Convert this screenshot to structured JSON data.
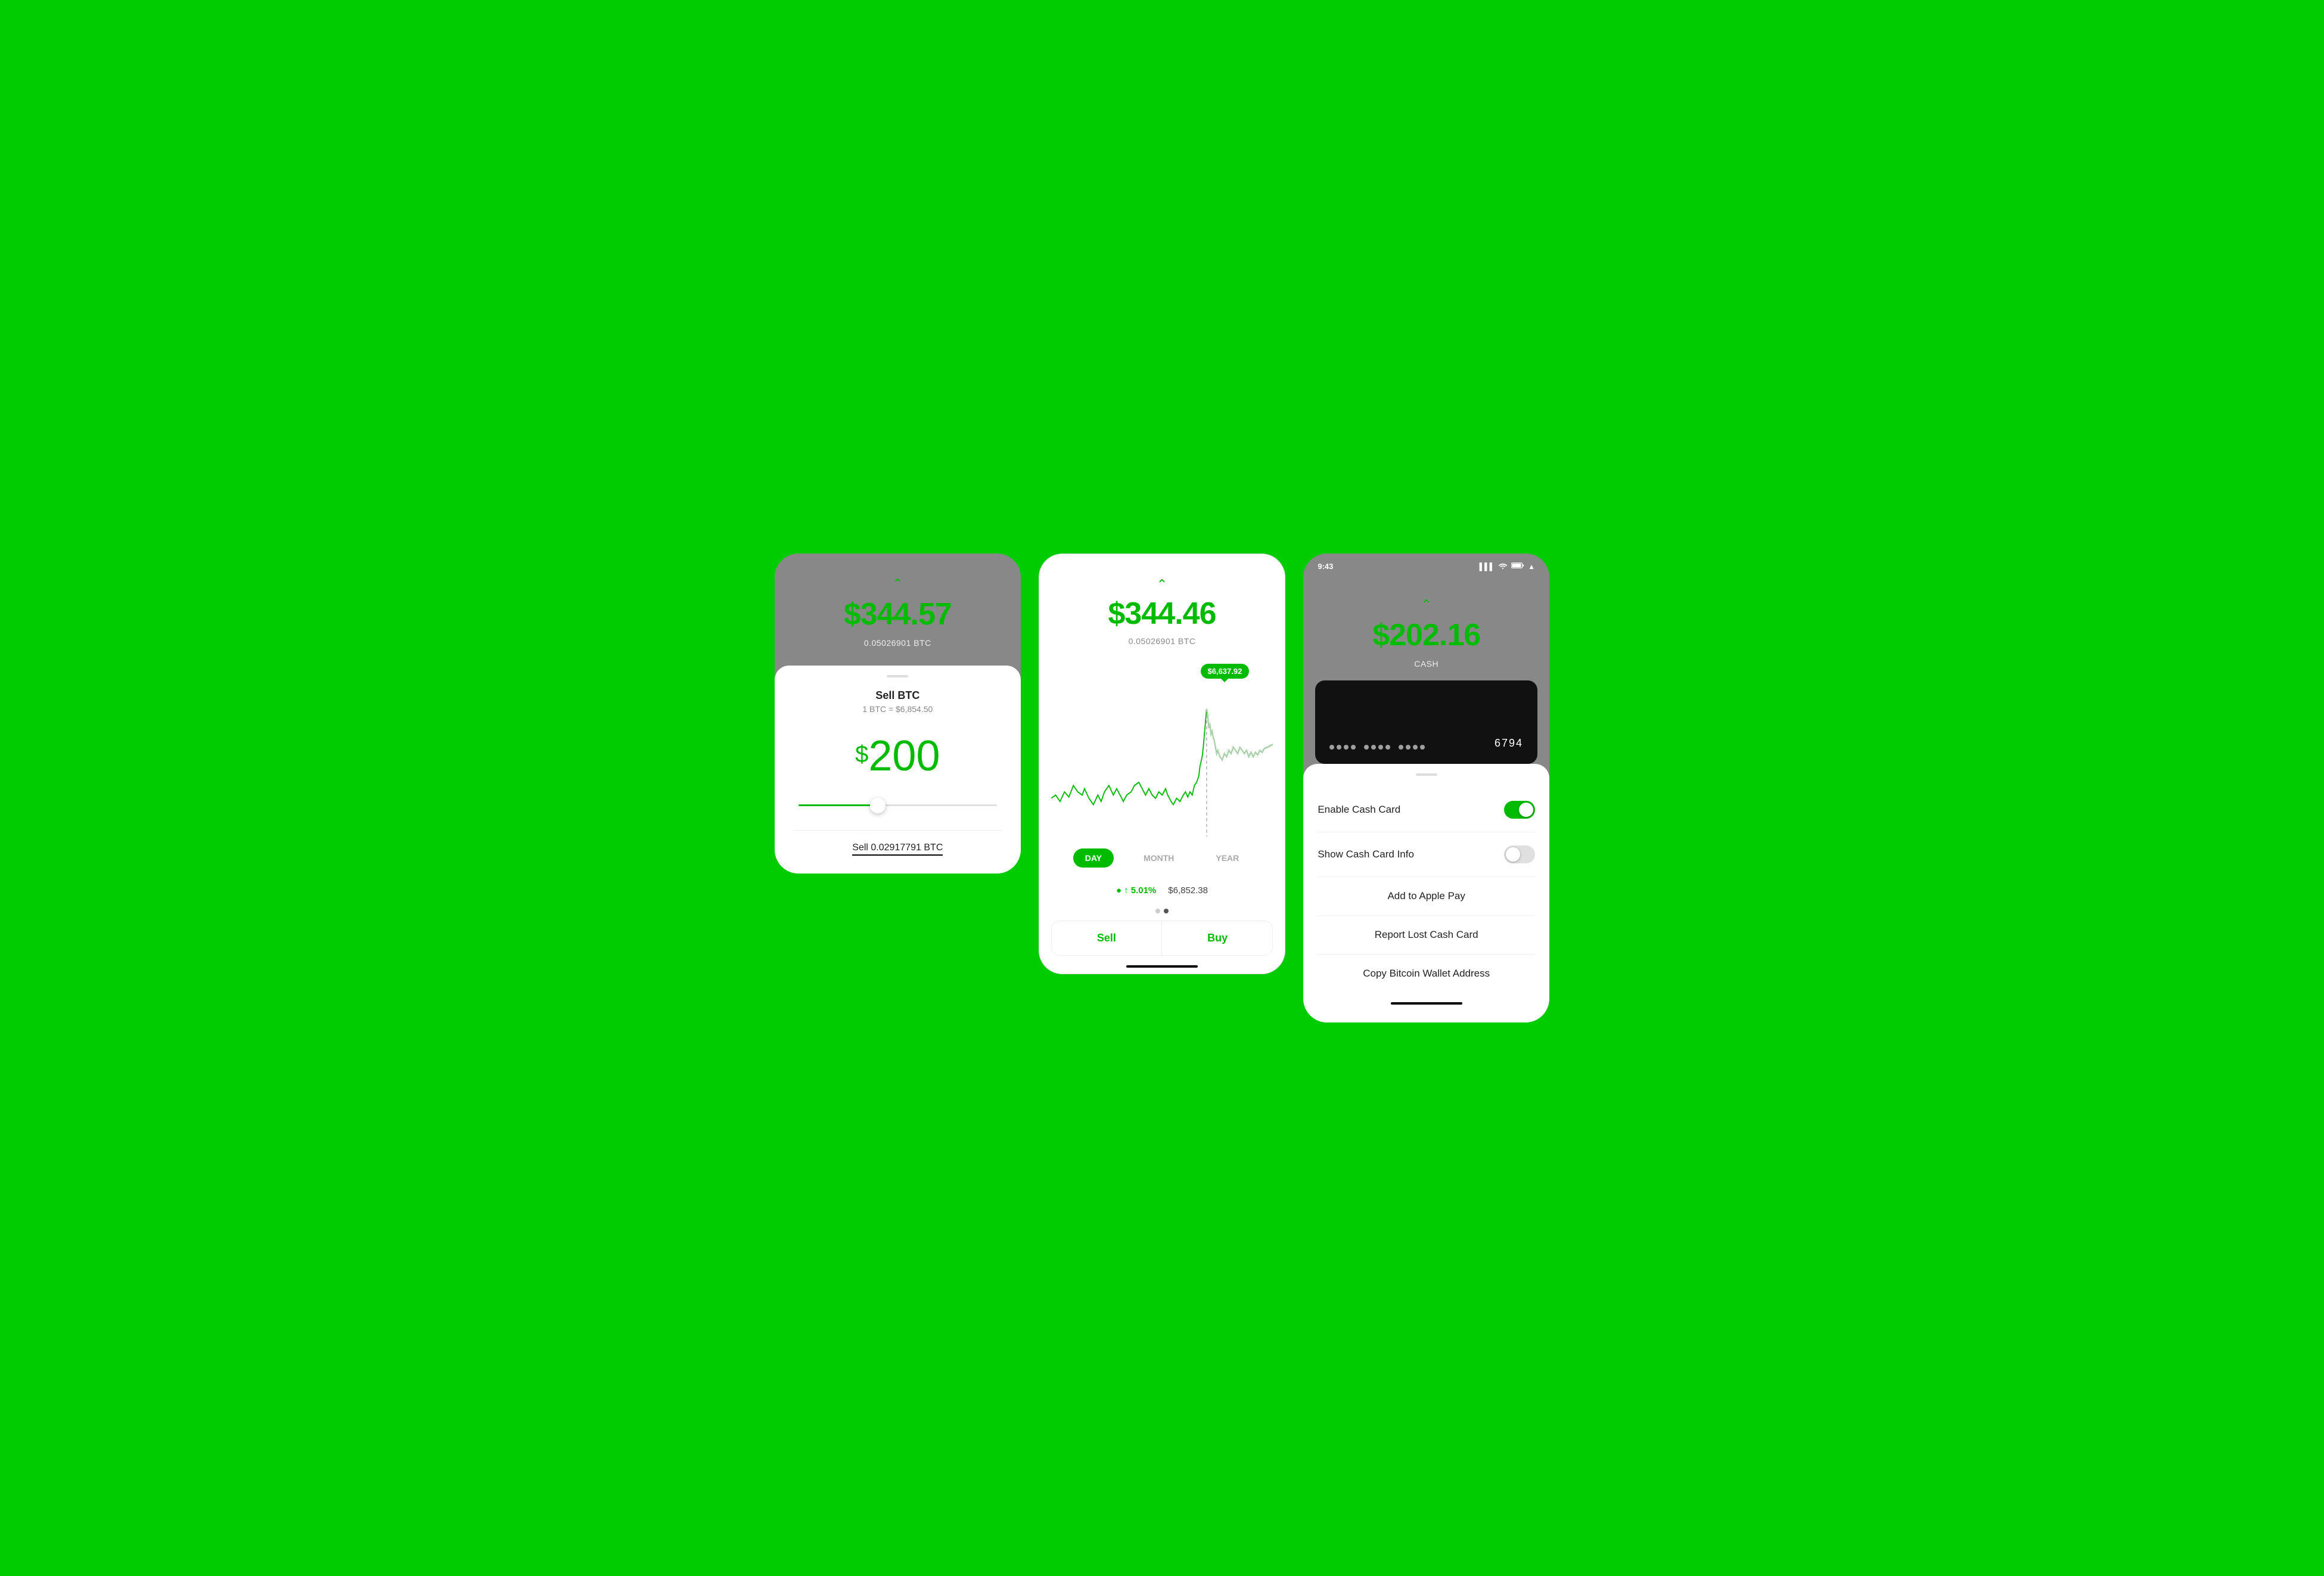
{
  "background_color": "#00CC00",
  "panel1": {
    "balance": "$344.57",
    "balance_btc": "0.05026901 BTC",
    "sheet_title": "Sell BTC",
    "rate": "1 BTC = $6,854.50",
    "sell_amount_dollar": "$",
    "sell_amount": "200",
    "slider_percent": 40,
    "footer_text": "Sell 0.02917791 BTC"
  },
  "panel2": {
    "balance": "$344.46",
    "balance_btc": "0.05026901 BTC",
    "tooltip_price": "$6,637.92",
    "time_options": [
      "DAY",
      "MONTH",
      "YEAR"
    ],
    "active_time": "DAY",
    "stat_change": "↑ 5.01%",
    "stat_price": "$6,852.38",
    "sell_label": "Sell",
    "buy_label": "Buy"
  },
  "panel3": {
    "status_time": "9:43",
    "balance": "$202.16",
    "balance_label": "CASH",
    "card_last4": "6794",
    "enable_cash_card_label": "Enable Cash Card",
    "enable_cash_card_on": true,
    "show_cash_card_info_label": "Show Cash Card Info",
    "show_cash_card_info_on": false,
    "add_apple_pay_label": "Add to Apple Pay",
    "report_lost_label": "Report Lost Cash Card",
    "bitcoin_wallet_label": "Copy Bitcoin Wallet Address"
  },
  "icons": {
    "chevron": "^",
    "signal": "▌▌▌",
    "wifi": "wifi",
    "battery": "battery"
  }
}
